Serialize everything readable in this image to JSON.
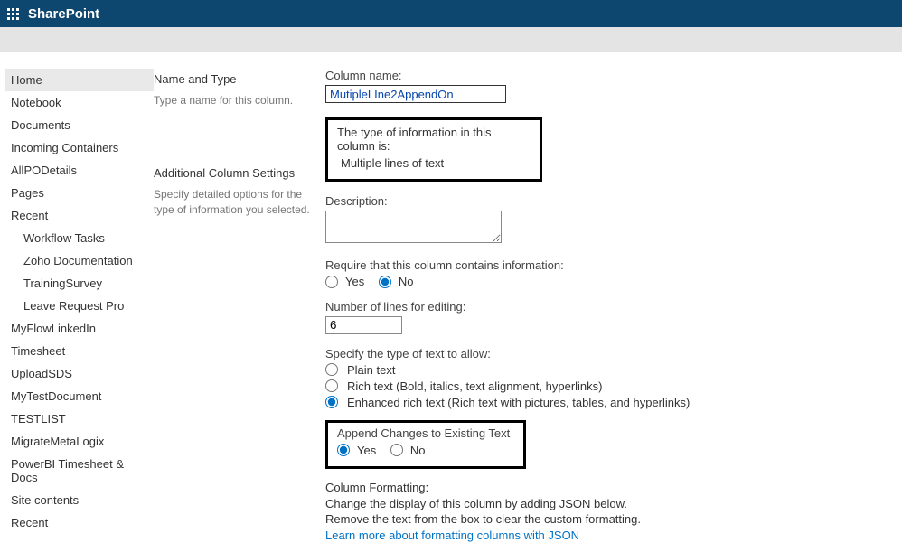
{
  "topbar": {
    "title": "SharePoint"
  },
  "nav": {
    "items": [
      {
        "label": "Home",
        "active": true,
        "indent": false
      },
      {
        "label": "Notebook",
        "indent": false
      },
      {
        "label": "Documents",
        "indent": false
      },
      {
        "label": "Incoming Containers",
        "indent": false
      },
      {
        "label": "AllPODetails",
        "indent": false
      },
      {
        "label": "Pages",
        "indent": false
      },
      {
        "label": "Recent",
        "indent": false
      },
      {
        "label": "Workflow Tasks",
        "indent": true
      },
      {
        "label": "Zoho Documentation",
        "indent": true
      },
      {
        "label": "TrainingSurvey",
        "indent": true
      },
      {
        "label": "Leave Request Pro",
        "indent": true
      },
      {
        "label": "MyFlowLinkedIn",
        "indent": false
      },
      {
        "label": "Timesheet",
        "indent": false
      },
      {
        "label": "UploadSDS",
        "indent": false
      },
      {
        "label": "MyTestDocument",
        "indent": false
      },
      {
        "label": "TESTLIST",
        "indent": false
      },
      {
        "label": "MigrateMetaLogix",
        "indent": false
      },
      {
        "label": "PowerBI Timesheet & Docs",
        "indent": false
      },
      {
        "label": "Site contents",
        "indent": false
      },
      {
        "label": "Recent",
        "indent": false
      }
    ]
  },
  "mid": {
    "nameandtype_head": "Name and Type",
    "nameandtype_sub": "Type a name for this column.",
    "addl_head": "Additional Column Settings",
    "addl_sub": "Specify detailed options for the type of information you selected."
  },
  "main": {
    "colname_label": "Column name:",
    "colname_value": "MutipleLIne2AppendOn",
    "typeinfo_label": "The type of information in this column is:",
    "typeinfo_value": "Multiple lines of text",
    "desc_label": "Description:",
    "require_label": "Require that this column contains information:",
    "yes": "Yes",
    "no": "No",
    "numlines_label": "Number of lines for editing:",
    "numlines_value": "6",
    "texttype_label": "Specify the type of text to allow:",
    "plain": "Plain text",
    "rich": "Rich text (Bold, italics, text alignment, hyperlinks)",
    "enhanced": "Enhanced rich text (Rich text with pictures, tables, and hyperlinks)",
    "append_label": "Append Changes to Existing Text",
    "format_head": "Column Formatting:",
    "format_l1": "Change the display of this column by adding JSON below.",
    "format_l2": "Remove the text from the box to clear the custom formatting.",
    "format_link": "Learn more about formatting columns with JSON"
  }
}
